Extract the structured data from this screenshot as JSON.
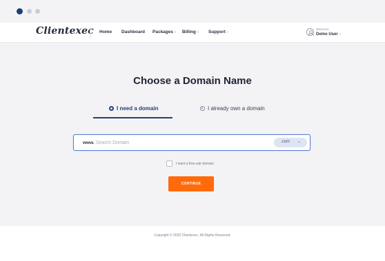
{
  "brand": {
    "logo_text": "Clientexec",
    "accent_color": "#1f3f78",
    "cta_color": "#ff6b0a"
  },
  "window_dots": [
    "active",
    "inactive",
    "inactive"
  ],
  "nav": {
    "items": [
      {
        "label": "Home"
      },
      {
        "label": "Dashboard"
      },
      {
        "label": "Packages",
        "has_dropdown": true
      },
      {
        "label": "Billing",
        "has_dropdown": true
      },
      {
        "label": "Support",
        "has_dropdown": true
      }
    ]
  },
  "user": {
    "welcome": "Welcome",
    "name": "Demo User",
    "icon": "user-icon"
  },
  "main": {
    "title": "Choose a Domain Name",
    "tabs": [
      {
        "label": "I need a domain",
        "selected": true
      },
      {
        "label": "I already own a domain",
        "selected": false
      }
    ],
    "search": {
      "prefix": "www.",
      "placeholder": "Search Domain",
      "tld": ".com"
    },
    "subdomain_label": "I want a free sub domain",
    "continue_label": "CONTINUE"
  },
  "footer": {
    "copyright": "Copyright © 2020 Clientexec. All Rights Reserved."
  }
}
